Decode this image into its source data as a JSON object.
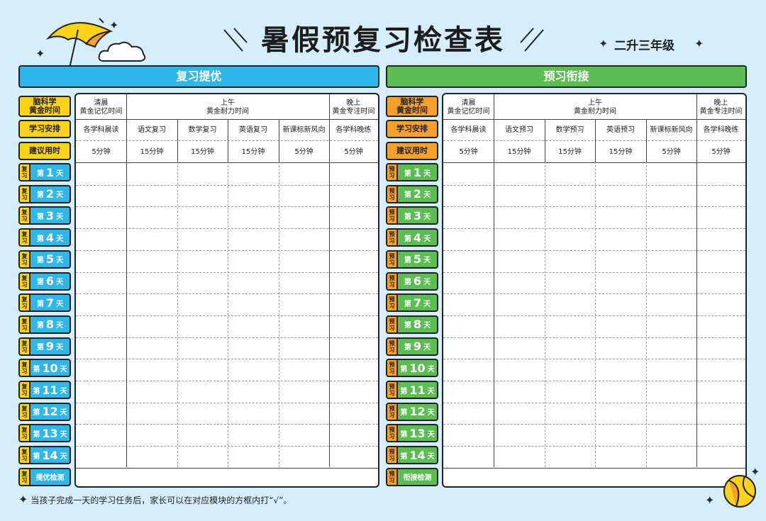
{
  "title": "暑假预复习检查表",
  "grade": "二升三年级",
  "footnote": "当孩子完成一天的学习任务后，家长可以在对应模块的方框内打“√”。",
  "colors": {
    "background": "#d6eefb",
    "review_blue": "#2fb7ea",
    "preview_green": "#5cbd52",
    "label_yellow": "#fcd21a",
    "label_orange": "#f7a02e"
  },
  "row_labels": [
    "脑科学\n黄金时间",
    "学习安排",
    "建议用时"
  ],
  "review": {
    "banner": "复习提优",
    "tag": "复习",
    "final_label": "提优检测",
    "time_headers": [
      "清晨\n黄金记忆时间",
      "上午\n黄金耐力时间",
      "晚上\n黄金专注时间"
    ],
    "tasks": [
      "各学科晨读",
      "语文复习",
      "数学复习",
      "英语复习",
      "新课标新风向",
      "各学科晚练"
    ],
    "durations": [
      "5分钟",
      "15分钟",
      "15分钟",
      "15分钟",
      "5分钟",
      "5分钟"
    ]
  },
  "preview": {
    "banner": "预习衔接",
    "tag": "预习",
    "final_label": "衔接检测",
    "time_headers": [
      "清晨\n黄金记忆时间",
      "上午\n黄金耐力时间",
      "晚上\n黄金专注时间"
    ],
    "tasks": [
      "各学科晨读",
      "语文预习",
      "数学预习",
      "英语预习",
      "新课标新风向",
      "各学科晚练"
    ],
    "durations": [
      "5分钟",
      "15分钟",
      "15分钟",
      "15分钟",
      "5分钟",
      "5分钟"
    ]
  },
  "day_prefix": "第",
  "day_suffix": "天",
  "days": [
    "1",
    "2",
    "3",
    "4",
    "5",
    "6",
    "7",
    "8",
    "9",
    "10",
    "11",
    "12",
    "13",
    "14"
  ],
  "icons": [
    "umbrella-icon",
    "cloud-icon",
    "beach-ball-icon",
    "sparkle-icon",
    "slash-decoration-icon"
  ]
}
